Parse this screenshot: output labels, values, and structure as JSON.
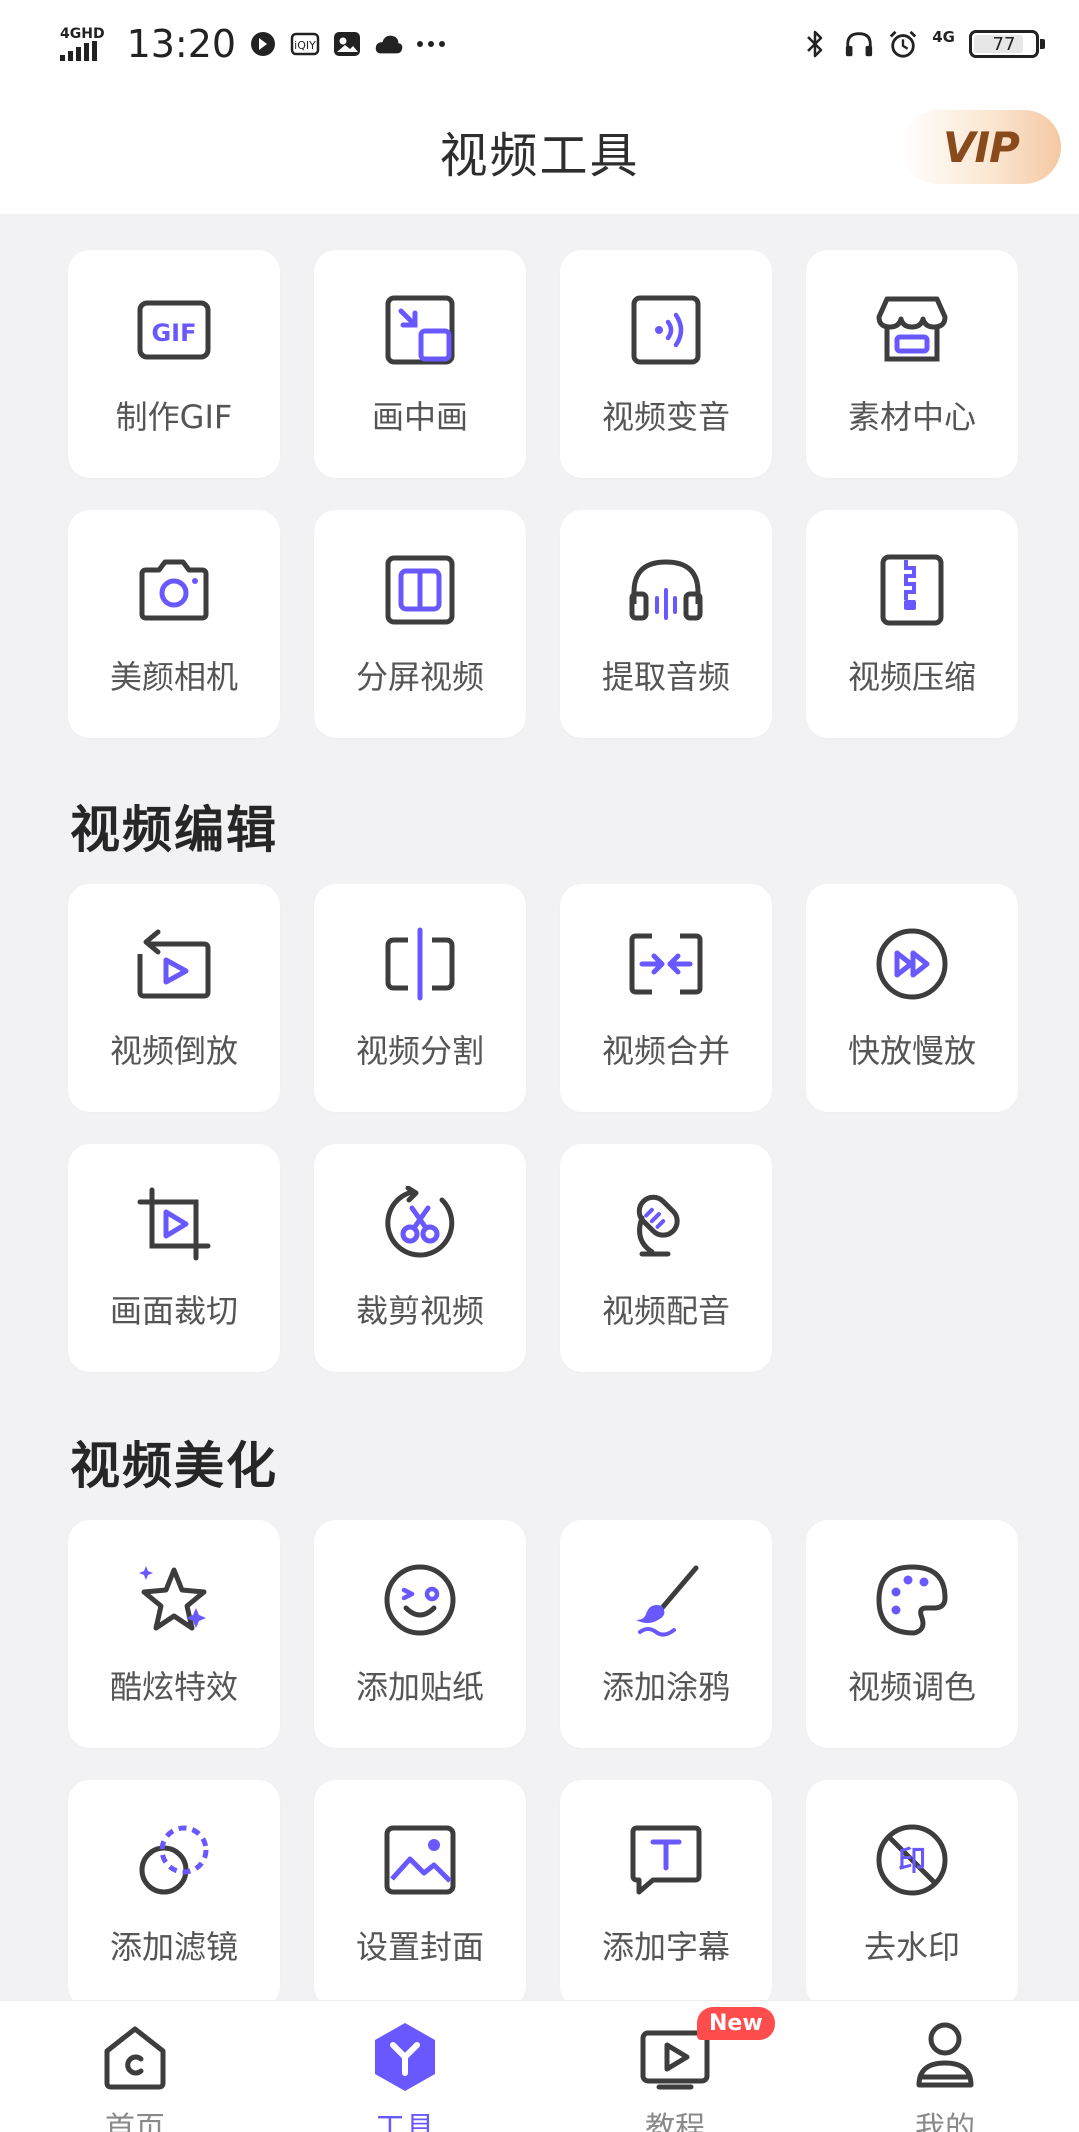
{
  "status_bar": {
    "network": "4GHD",
    "time": "13:20",
    "network_right": "4G",
    "battery": "77",
    "battery_level": 0.77,
    "left_icons": [
      "dnd-icon",
      "iqiyi-icon",
      "gallery-icon",
      "cloud-icon",
      "more-dots-icon"
    ],
    "right_icons": [
      "bluetooth-icon",
      "headphones-icon",
      "alarm-icon"
    ]
  },
  "header": {
    "title": "视频工具",
    "vip_label": "VIP"
  },
  "colors": {
    "accent": "#6a58ff",
    "icon_dark": "#3d3d3d",
    "background": "#f2f2f4",
    "vip_text": "#8a4b1c",
    "new_badge": "#ff4c4c"
  },
  "tools": {
    "row1": [
      {
        "label": "制作GIF",
        "icon": "gif-icon"
      },
      {
        "label": "画中画",
        "icon": "picture-in-picture-icon"
      },
      {
        "label": "视频变音",
        "icon": "voice-change-icon"
      },
      {
        "label": "素材中心",
        "icon": "store-icon"
      }
    ],
    "row2": [
      {
        "label": "美颜相机",
        "icon": "camera-icon"
      },
      {
        "label": "分屏视频",
        "icon": "split-screen-icon"
      },
      {
        "label": "提取音频",
        "icon": "headphones-icon"
      },
      {
        "label": "视频压缩",
        "icon": "zip-icon"
      }
    ]
  },
  "sections": {
    "edit": {
      "title": "视频编辑",
      "items": [
        {
          "label": "视频倒放",
          "icon": "reverse-play-icon"
        },
        {
          "label": "视频分割",
          "icon": "split-icon"
        },
        {
          "label": "视频合并",
          "icon": "merge-icon"
        },
        {
          "label": "快放慢放",
          "icon": "fast-forward-icon"
        },
        {
          "label": "画面裁切",
          "icon": "crop-icon"
        },
        {
          "label": "裁剪视频",
          "icon": "scissors-icon"
        },
        {
          "label": "视频配音",
          "icon": "microphone-icon"
        }
      ]
    },
    "beautify": {
      "title": "视频美化",
      "items": [
        {
          "label": "酷炫特效",
          "icon": "star-sparkle-icon"
        },
        {
          "label": "添加贴纸",
          "icon": "sticker-face-icon"
        },
        {
          "label": "添加涂鸦",
          "icon": "brush-icon"
        },
        {
          "label": "视频调色",
          "icon": "palette-icon"
        },
        {
          "label": "添加滤镜",
          "icon": "filter-icon"
        },
        {
          "label": "设置封面",
          "icon": "image-icon"
        },
        {
          "label": "添加字幕",
          "icon": "subtitle-icon"
        },
        {
          "label": "去水印",
          "icon": "watermark-icon"
        }
      ]
    }
  },
  "bottom_nav": {
    "items": [
      {
        "label": "首页",
        "icon": "home-icon"
      },
      {
        "label": "工具",
        "icon": "tools-icon",
        "active": true
      },
      {
        "label": "教程",
        "icon": "tutorial-play-icon",
        "badge": "New"
      },
      {
        "label": "我的",
        "icon": "profile-icon"
      }
    ]
  }
}
